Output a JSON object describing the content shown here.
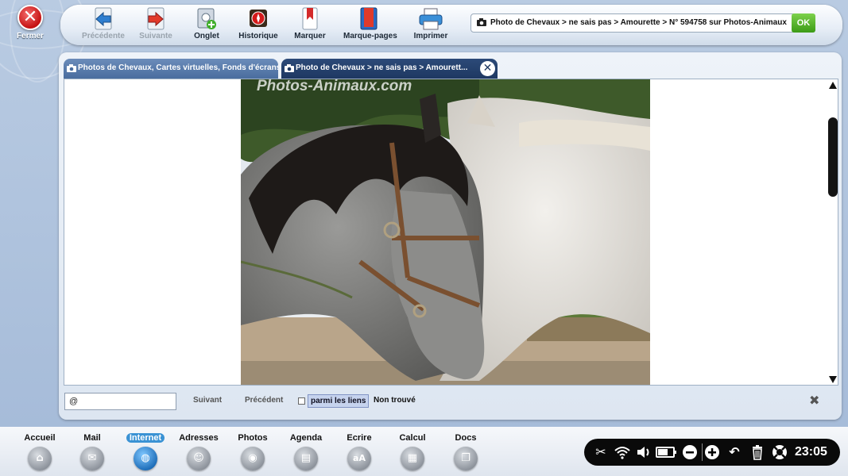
{
  "close": {
    "label": "Fermer"
  },
  "toolbar": {
    "items": [
      {
        "label": "Précédente",
        "icon": "back-arrow-icon",
        "enabled": false
      },
      {
        "label": "Suivante",
        "icon": "forward-arrow-icon",
        "enabled": false
      },
      {
        "label": "Onglet",
        "icon": "new-tab-icon",
        "enabled": true
      },
      {
        "label": "Historique",
        "icon": "history-compass-icon",
        "enabled": true
      },
      {
        "label": "Marquer",
        "icon": "bookmark-icon",
        "enabled": true
      },
      {
        "label": "Marque-pages",
        "icon": "bookmarks-book-icon",
        "enabled": true
      },
      {
        "label": "Imprimer",
        "icon": "printer-icon",
        "enabled": true
      }
    ]
  },
  "address": {
    "value": "Photo de Chevaux > ne sais pas > Amourette > N° 594758 sur Photos-Animaux",
    "go_label": "OK"
  },
  "tabs": [
    {
      "label": "Photos de Chevaux, Cartes virtuelles, Fonds d'écrans",
      "active": false
    },
    {
      "label": "Photo de Chevaux > ne sais pas > Amourett...",
      "active": true
    }
  ],
  "content": {
    "watermark": "Photos-Animaux.com"
  },
  "find": {
    "value": "@",
    "next_label": "Suivant",
    "prev_label": "Précédent",
    "links_label": "parmi les liens",
    "status": "Non trouvé"
  },
  "dock": {
    "items": [
      {
        "label": "Accueil",
        "icon": "home-icon",
        "active": false
      },
      {
        "label": "Mail",
        "icon": "mail-icon",
        "active": false
      },
      {
        "label": "Internet",
        "icon": "globe-icon",
        "active": true
      },
      {
        "label": "Adresses",
        "icon": "contacts-icon",
        "active": false
      },
      {
        "label": "Photos",
        "icon": "camera-icon",
        "active": false
      },
      {
        "label": "Agenda",
        "icon": "agenda-icon",
        "active": false
      },
      {
        "label": "Ecrire",
        "icon": "write-icon",
        "active": false
      },
      {
        "label": "Calcul",
        "icon": "calculator-icon",
        "active": false
      },
      {
        "label": "Docs",
        "icon": "docs-icon",
        "active": false
      }
    ]
  },
  "tray": {
    "time": "23:05"
  },
  "colors": {
    "accent": "#3a92d4",
    "ok_green": "#3c9b16",
    "close_red": "#c41212",
    "active_tab": "#1e3862"
  }
}
